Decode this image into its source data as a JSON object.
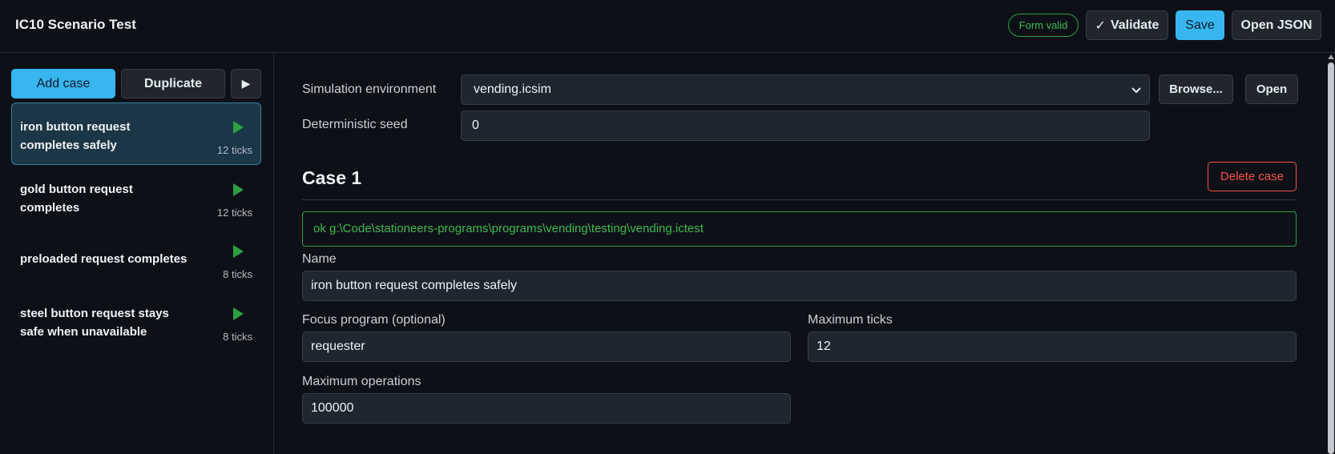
{
  "header": {
    "title": "IC10 Scenario Test",
    "status_badge": "Form valid",
    "validate_check": "✓",
    "validate_label": "Validate",
    "save_label": "Save",
    "open_json_label": "Open JSON"
  },
  "sidebar": {
    "add_case_label": "Add case",
    "duplicate_label": "Duplicate",
    "run_all_icon": "▶",
    "cases": [
      {
        "title": "iron button request completes safely",
        "ticks": "12 ticks"
      },
      {
        "title": "gold button request completes",
        "ticks": "12 ticks"
      },
      {
        "title": "preloaded request completes",
        "ticks": "8 ticks"
      },
      {
        "title": "steel button request stays safe when unavailable",
        "ticks": "8 ticks"
      }
    ]
  },
  "settings": {
    "simulation_label": "Simulation environment",
    "simulation_value": "vending.icsim",
    "browse_label": "Browse...",
    "open_label": "Open",
    "seed_label": "Deterministic seed",
    "seed_value": "0"
  },
  "case": {
    "heading": "Case 1",
    "delete_label": "Delete case",
    "status_text": "ok g:\\Code\\stationeers-programs\\programs\\vending\\testing\\vending.ictest",
    "name_label": "Name",
    "name_value": "iron button request completes safely",
    "focus_label": "Focus program (optional)",
    "focus_value": "requester",
    "max_ticks_label": "Maximum ticks",
    "max_ticks_value": "12",
    "max_ops_label": "Maximum operations",
    "max_ops_value": "100000"
  },
  "colors": {
    "accent": "#38b6ef",
    "success": "#3fb950",
    "danger": "#f85149",
    "background": "#0d1117"
  }
}
